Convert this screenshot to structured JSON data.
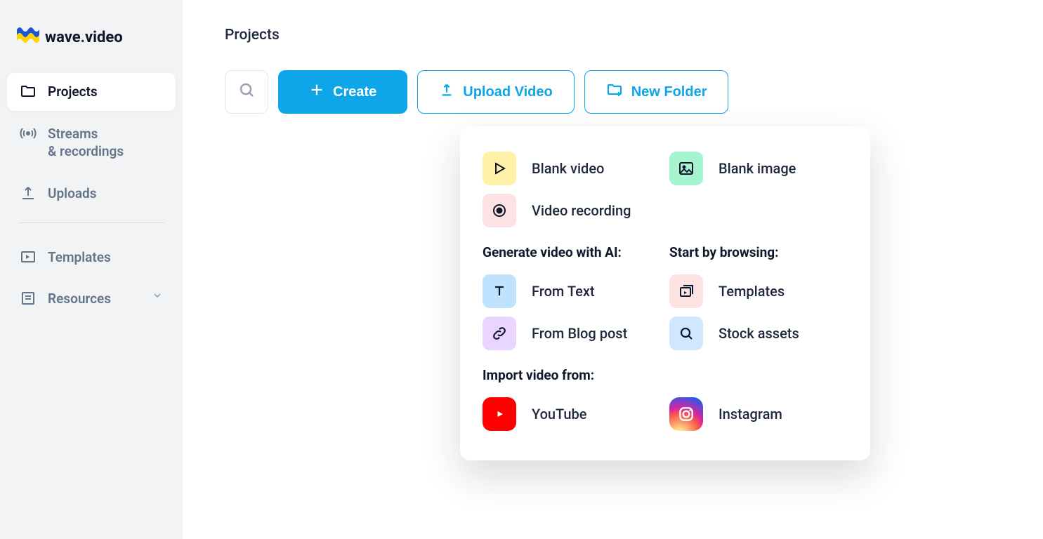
{
  "brand": {
    "name": "wave.video"
  },
  "sidebar": {
    "items": [
      {
        "label": "Projects"
      },
      {
        "label": "Streams\n& recordings"
      },
      {
        "label": "Uploads"
      },
      {
        "label": "Templates"
      },
      {
        "label": "Resources"
      }
    ]
  },
  "page": {
    "title": "Projects"
  },
  "toolbar": {
    "create_label": "Create",
    "upload_label": "Upload Video",
    "new_folder_label": "New Folder"
  },
  "create_menu": {
    "blank_video": "Blank video",
    "blank_image": "Blank image",
    "video_recording": "Video recording",
    "heading_ai": "Generate video with AI:",
    "from_text": "From Text",
    "from_blog": "From Blog post",
    "heading_browse": "Start by browsing:",
    "templates": "Templates",
    "stock_assets": "Stock assets",
    "heading_import": "Import video from:",
    "youtube": "YouTube",
    "instagram": "Instagram"
  }
}
